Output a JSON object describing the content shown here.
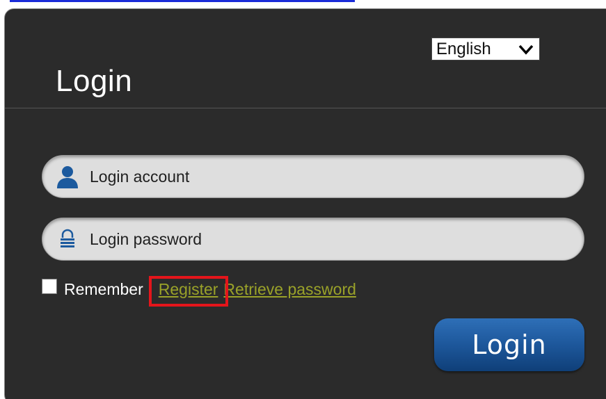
{
  "language": {
    "selected": "English"
  },
  "header": {
    "title": "Login"
  },
  "form": {
    "account_placeholder": "Login account",
    "password_placeholder": "Login password",
    "remember_label": "Remember",
    "remember_checked": false,
    "register_link": "Register",
    "retrieve_password_link": "Retrieve password",
    "submit_label": "Login"
  },
  "icons": {
    "account": "user-icon",
    "password": "lock-icon",
    "language": "chevron-down-icon"
  },
  "colors": {
    "panel_background": "#2b2b2b",
    "link": "#9aa229",
    "button": "#1d579b",
    "highlight": "#e4151b",
    "top_bar": "#1a2bd8"
  }
}
